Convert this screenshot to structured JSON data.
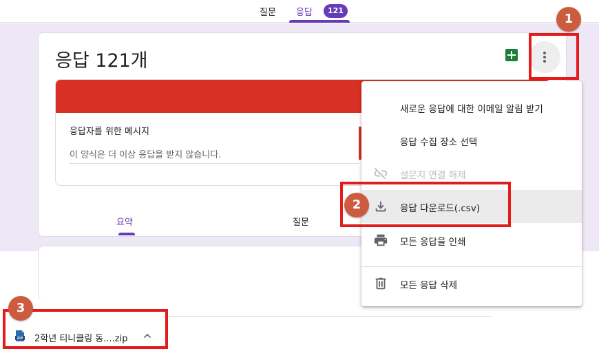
{
  "top_tabs": {
    "questions": "질문",
    "responses": "응답",
    "responses_count": "121"
  },
  "card": {
    "title": "응답 121개",
    "message_label": "응답자를 위한 메시지",
    "message_text": "이 양식은 더 이상 응답을 받지 않습니다.",
    "subtabs": {
      "summary": "요약",
      "questions": "질문"
    }
  },
  "menu": {
    "items": [
      {
        "label": "새로운 응답에 대한 이메일 알림 받기",
        "icon": "none",
        "enabled": true
      },
      {
        "label": "응답 수집 장소 선택",
        "icon": "none",
        "enabled": true
      },
      {
        "label": "설문지 연결 해제",
        "icon": "unlink-icon",
        "enabled": false
      },
      {
        "label": "응답 다운로드(.csv)",
        "icon": "download-icon",
        "enabled": true
      },
      {
        "label": "모든 응답을 인쇄",
        "icon": "print-icon",
        "enabled": true
      },
      {
        "label": "모든 응답 삭제",
        "icon": "trash-icon",
        "enabled": true
      }
    ]
  },
  "annotations": {
    "step1": "1",
    "step2": "2",
    "step3": "3"
  },
  "download_bar": {
    "file_name": "2학년 티니클링 동....zip",
    "file_icon": "zip-icon"
  },
  "colors": {
    "accent": "#673ab7",
    "header_band": "#d93025",
    "annotation_box": "#e41b1b",
    "annotation_circle": "#cd5b40",
    "background": "#ede7f6"
  }
}
